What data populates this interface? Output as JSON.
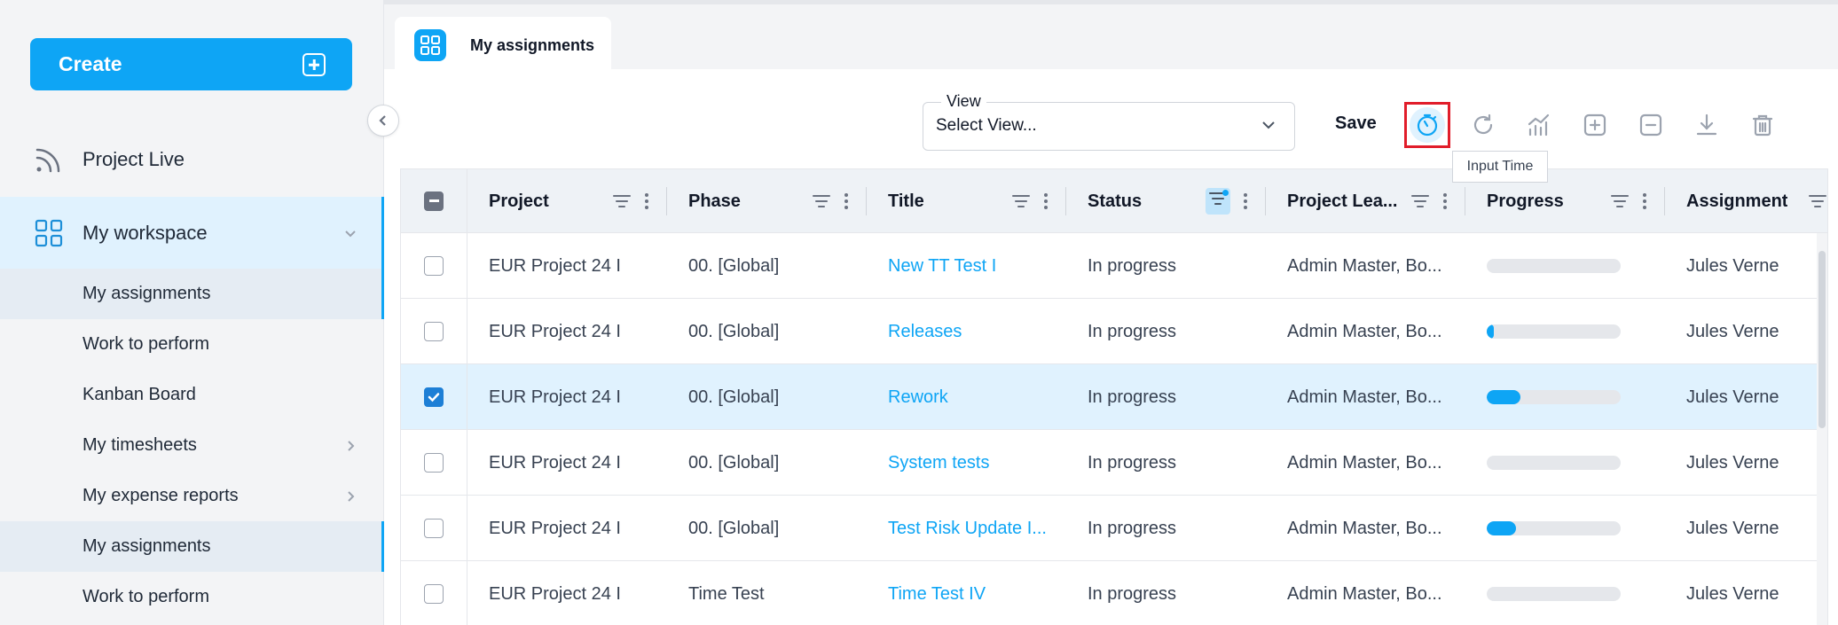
{
  "sidebar": {
    "create_label": "Create",
    "project_live_label": "Project Live",
    "workspace_label": "My workspace",
    "items": [
      {
        "label": "My assignments",
        "active": true,
        "has_chevron": false
      },
      {
        "label": "Work to perform",
        "active": false,
        "has_chevron": false
      },
      {
        "label": "Kanban Board",
        "active": false,
        "has_chevron": false
      },
      {
        "label": "My timesheets",
        "active": false,
        "has_chevron": true
      },
      {
        "label": "My expense reports",
        "active": false,
        "has_chevron": true
      },
      {
        "label": "My assignments",
        "active": true,
        "has_chevron": false
      },
      {
        "label": "Work to perform",
        "active": false,
        "has_chevron": false
      }
    ]
  },
  "tab": {
    "label": "My assignments"
  },
  "toolbar": {
    "view_label": "View",
    "view_value": "Select View...",
    "save_label": "Save",
    "tooltip": "Input Time",
    "icons": [
      "timer-icon",
      "refresh-icon",
      "chart-icon",
      "expand-icon",
      "collapse-icon",
      "download-icon",
      "delete-icon"
    ]
  },
  "grid": {
    "columns": [
      "Project",
      "Phase",
      "Title",
      "Status",
      "Project Lea...",
      "Progress",
      "Assignment"
    ],
    "rows": [
      {
        "project": "EUR Project 24 I",
        "phase": "00. [Global]",
        "title": "New TT Test I",
        "status": "In progress",
        "lead": "Admin Master, Bo...",
        "progress": 0,
        "assignment": "Jules Verne",
        "selected": false
      },
      {
        "project": "EUR Project 24 I",
        "phase": "00. [Global]",
        "title": "Releases",
        "status": "In progress",
        "lead": "Admin Master, Bo...",
        "progress": 0.05,
        "assignment": "Jules Verne",
        "selected": false
      },
      {
        "project": "EUR Project 24 I",
        "phase": "00. [Global]",
        "title": "Rework",
        "status": "In progress",
        "lead": "Admin Master, Bo...",
        "progress": 0.25,
        "assignment": "Jules Verne",
        "selected": true
      },
      {
        "project": "EUR Project 24 I",
        "phase": "00. [Global]",
        "title": "System tests",
        "status": "In progress",
        "lead": "Admin Master, Bo...",
        "progress": 0,
        "assignment": "Jules Verne",
        "selected": false
      },
      {
        "project": "EUR Project 24 I",
        "phase": "00. [Global]",
        "title": "Test Risk Update I...",
        "status": "In progress",
        "lead": "Admin Master, Bo...",
        "progress": 0.22,
        "assignment": "Jules Verne",
        "selected": false
      },
      {
        "project": "EUR Project 24 I",
        "phase": "Time Test",
        "title": "Time Test IV",
        "status": "In progress",
        "lead": "Admin Master, Bo...",
        "progress": 0,
        "assignment": "Jules Verne",
        "selected": false
      }
    ]
  },
  "colors": {
    "accent": "#0ea5f5",
    "highlight": "#e11d2a",
    "selected_row": "#e0f2fe"
  }
}
